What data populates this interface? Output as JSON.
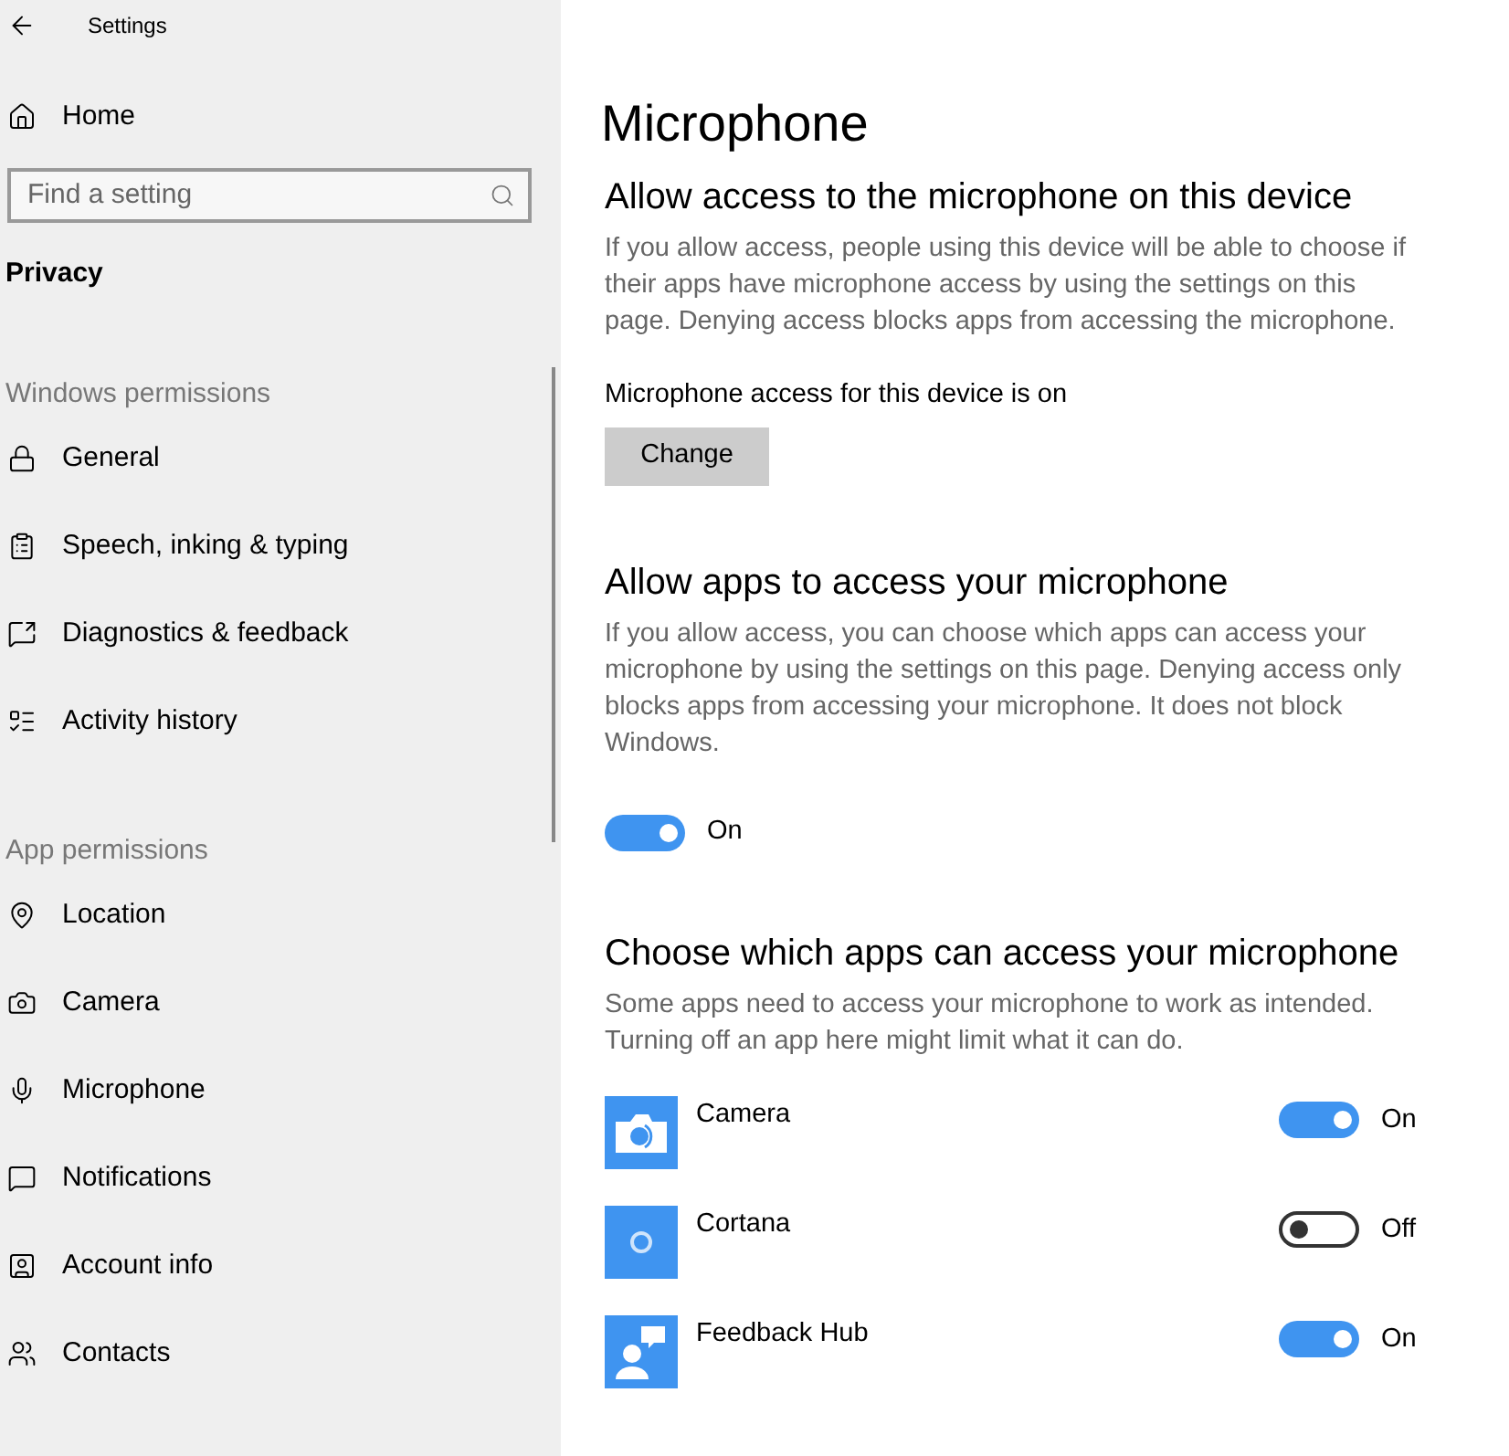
{
  "window": {
    "title": "Settings"
  },
  "sidebar": {
    "home": "Home",
    "search": {
      "placeholder": "Find a setting"
    },
    "section_title": "Privacy",
    "groups": [
      {
        "heading": "Windows permissions",
        "items": [
          {
            "label": "General"
          },
          {
            "label": "Speech, inking & typing"
          },
          {
            "label": "Diagnostics & feedback"
          },
          {
            "label": "Activity history"
          }
        ]
      },
      {
        "heading": "App permissions",
        "items": [
          {
            "label": "Location"
          },
          {
            "label": "Camera"
          },
          {
            "label": "Microphone"
          },
          {
            "label": "Notifications"
          },
          {
            "label": "Account info"
          },
          {
            "label": "Contacts"
          }
        ]
      }
    ]
  },
  "page": {
    "title": "Microphone",
    "device_section": {
      "heading": "Allow access to the microphone on this device",
      "description": "If you allow access, people using this device will be able to choose if their apps have microphone access by using the settings on this page. Denying access blocks apps from accessing the microphone.",
      "status": "Microphone access for this device is on",
      "button": "Change"
    },
    "apps_section": {
      "heading": "Allow apps to access your microphone",
      "description": "If you allow access, you can choose which apps can access your microphone by using the settings on this page. Denying access only blocks apps from accessing your microphone. It does not block Windows.",
      "toggle": {
        "on": true,
        "label": "On"
      }
    },
    "choose_section": {
      "heading": "Choose which apps can access your microphone",
      "description": "Some apps need to access your microphone to work as intended. Turning off an app here might limit what it can do.",
      "apps": [
        {
          "name": "Camera",
          "on": true,
          "state": "On"
        },
        {
          "name": "Cortana",
          "on": false,
          "state": "Off"
        },
        {
          "name": "Feedback Hub",
          "on": true,
          "state": "On"
        }
      ]
    }
  }
}
